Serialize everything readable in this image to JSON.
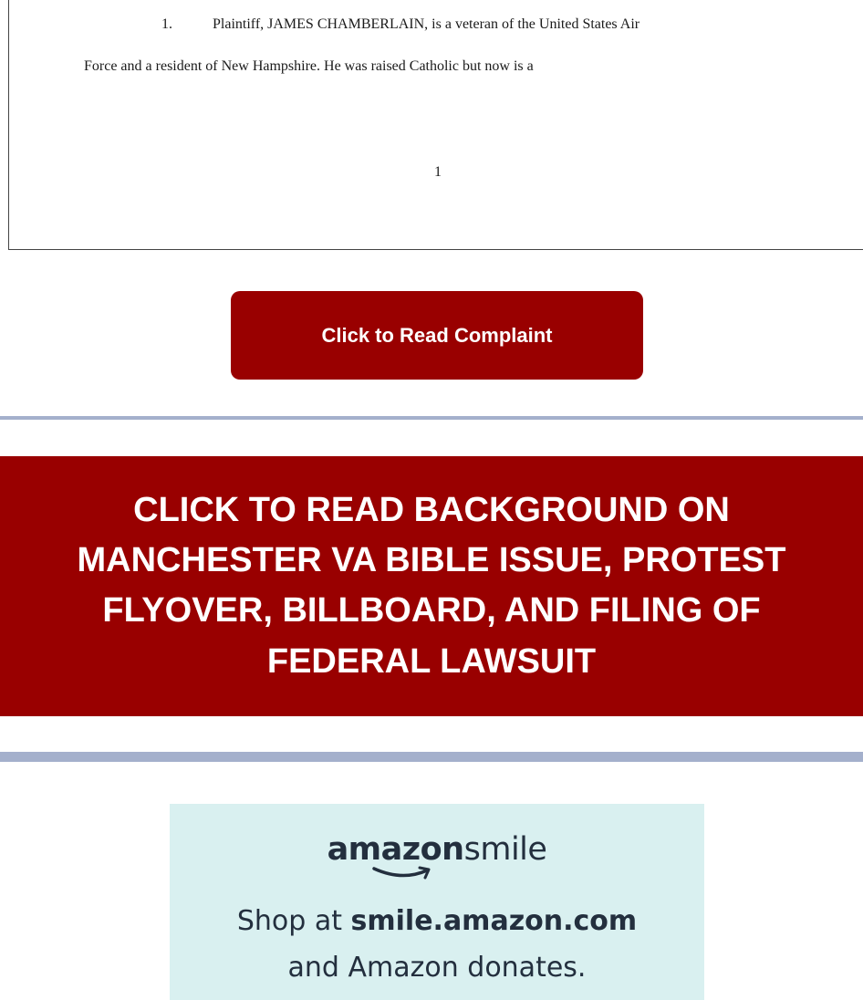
{
  "document": {
    "paragraph_number": "1.",
    "line1_text": "Plaintiff, JAMES CHAMBERLAIN, is a veteran of the United States Air",
    "line2_text": "Force and a resident of New Hampshire. He was raised Catholic but now is a",
    "page_number": "1"
  },
  "complaint_button": {
    "label": "Click to Read Complaint"
  },
  "background_banner": {
    "lines": [
      "CLICK TO READ BACKGROUND ON",
      "MANCHESTER VA BIBLE ISSUE, PROTEST",
      "FLYOVER, BILLBOARD, AND FILING OF",
      "FEDERAL LAWSUIT"
    ]
  },
  "amazon_smile": {
    "logo_bold": "amazon",
    "logo_light": "smile",
    "line1_prefix": "Shop at ",
    "line1_bold": "smile.amazon.com",
    "line2": "and Amazon donates."
  },
  "colors": {
    "accent_red": "#990000",
    "divider": "#a4b0cc",
    "smile_background": "#d9f0f0",
    "smile_text": "#232f3e"
  }
}
